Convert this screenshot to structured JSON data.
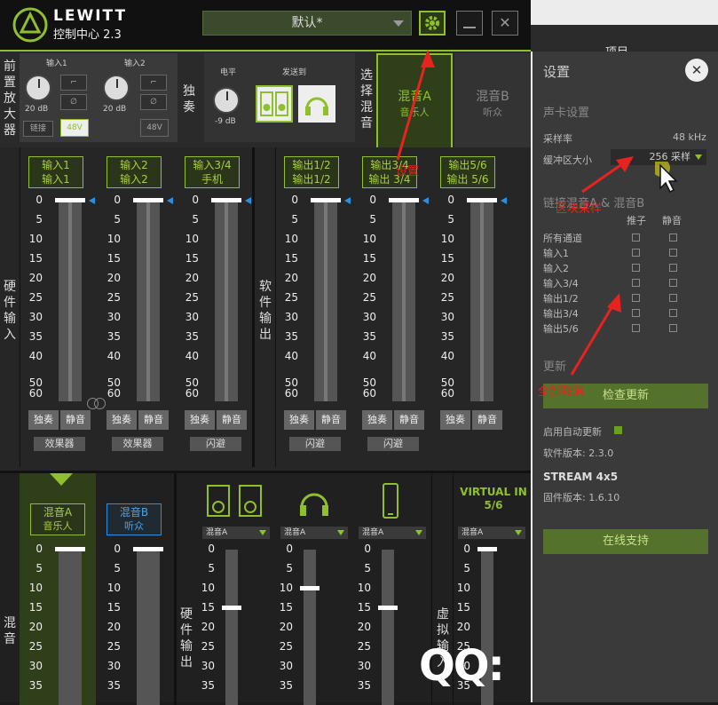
{
  "app": {
    "brand": "LEWITT",
    "subtitle": "控制中心 2.3"
  },
  "preset": {
    "value": "默认*"
  },
  "window_buttons": {
    "minimize": "—",
    "close": "✕"
  },
  "preamp": {
    "section_label": "前置放大器",
    "in1": {
      "label": "输入1",
      "gain": "20 dB",
      "link": "链接",
      "phantom": "48V"
    },
    "in2": {
      "label": "输入2",
      "gain": "20 dB",
      "phantom": "48V"
    }
  },
  "solo_label": "独奏",
  "monitor": {
    "level_label": "电平",
    "send_label": "发送到",
    "level_value": "-9 dB"
  },
  "mix_select": {
    "label": "选择混音",
    "mixA": {
      "name": "混音A",
      "sub": "音乐人"
    },
    "mixB": {
      "name": "混音B",
      "sub": "听众"
    }
  },
  "hardware_in_label": "硬件输入",
  "software_out_label": "软件输出",
  "scale": [
    "0",
    "5",
    "10",
    "15",
    "20",
    "25",
    "30",
    "35",
    "40",
    "50",
    "60"
  ],
  "channels_in": [
    {
      "l1": "输入1",
      "l2": "输入1",
      "solo": "独奏",
      "mute": "静音",
      "fx": "效果器"
    },
    {
      "l1": "输入2",
      "l2": "输入2",
      "solo": "独奏",
      "mute": "静音",
      "fx": "效果器"
    },
    {
      "l1": "输入3/4",
      "l2": "手机",
      "solo": "独奏",
      "mute": "静音",
      "fx": "闪避"
    }
  ],
  "channels_out": [
    {
      "l1": "输出1/2",
      "l2": "输出1/2",
      "solo": "独奏",
      "mute": "静音",
      "fx": "闪避"
    },
    {
      "l1": "输出3/4",
      "l2": "输出 3/4",
      "solo": "独奏",
      "mute": "静音",
      "fx": "闪避"
    },
    {
      "l1": "输出5/6",
      "l2": "输出 5/6",
      "solo": "独奏",
      "mute": "静音"
    }
  ],
  "mix_section": {
    "label": "混音",
    "mixA": {
      "name": "混音A",
      "sub": "音乐人"
    },
    "mixB": {
      "name": "混音B",
      "sub": "听众"
    },
    "hw_out_label": "硬件输出",
    "virtual_label": "虚拟输入",
    "dropdown_value": "混音A",
    "virtual_title": "VIRTUAL IN 5/6",
    "scale": [
      "0",
      "5",
      "10",
      "15",
      "20",
      "25",
      "30",
      "35"
    ],
    "fader_levels": {
      "speakers": 15,
      "headphones": 10,
      "phone": 15
    }
  },
  "background_menu": {
    "item": "项目"
  },
  "settings": {
    "title": "设置",
    "close": "✕",
    "soundcard_heading": "声卡设置",
    "sample_rate_label": "采样率",
    "sample_rate_value": "48 kHz",
    "buffer_label": "缓冲区大小",
    "buffer_value": "256 采样",
    "link_heading": "链接混音A & 混音B",
    "col_fader": "推子",
    "col_mute": "静音",
    "rows": [
      "所有通道",
      "输入1",
      "输入2",
      "输入3/4",
      "输出1/2",
      "输出3/4",
      "输出5/6"
    ],
    "update_heading": "更新",
    "check_update": "检查更新",
    "auto_update": "启用自动更新",
    "software_version": "软件版本: 2.3.0",
    "device": "STREAM 4x5",
    "firmware": "固件版本: 1.6.10",
    "support": "在线支持"
  },
  "annotations": {
    "settings": "设置",
    "buffer": "区块采样",
    "uncheck": "全部取消"
  },
  "watermark": "QQ:",
  "colors": {
    "accent": "#8fbf2c",
    "annotation": "#e8221e",
    "fader_marker": "#2a8fe0"
  }
}
